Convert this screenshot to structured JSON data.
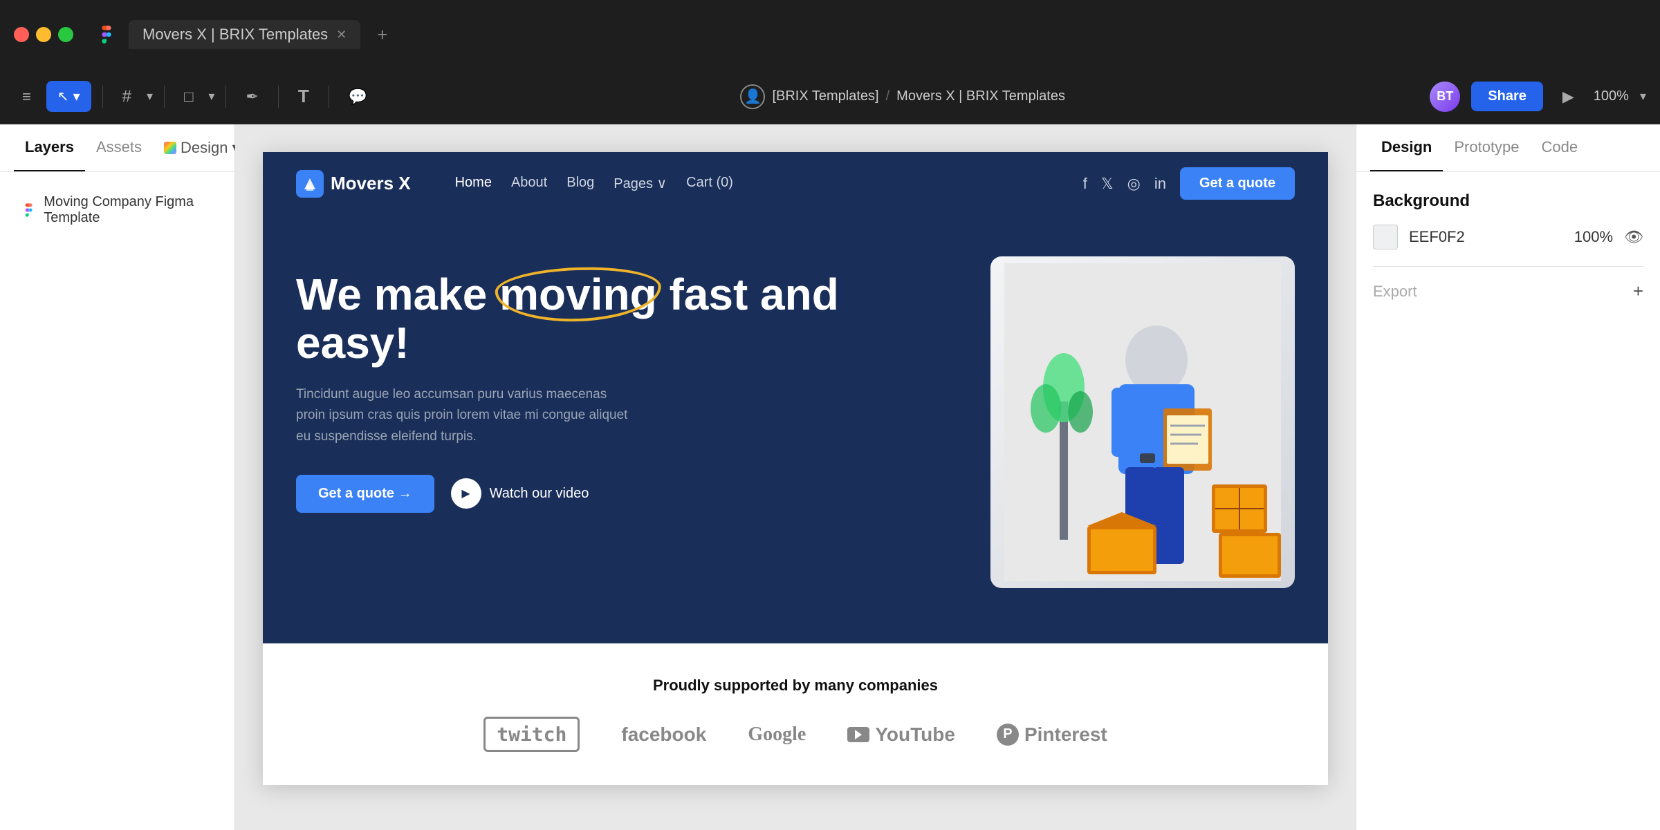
{
  "titlebar": {
    "tab_title": "Movers X | BRIX Templates",
    "plus_label": "+",
    "menu_icon": "≡",
    "figma_color_1": "#F24E1E",
    "figma_color_2": "#FF7262",
    "figma_color_3": "#A259FF",
    "figma_color_4": "#1ABCFE"
  },
  "toolbar": {
    "breadcrumb_org": "[BRIX Templates]",
    "breadcrumb_sep": "/",
    "breadcrumb_project": "Movers X | BRIX Templates",
    "share_label": "Share",
    "zoom_label": "100%"
  },
  "left_sidebar": {
    "tab_layers": "Layers",
    "tab_assets": "Assets",
    "tab_design": "Design",
    "layer_item": "Moving Company Figma Template"
  },
  "right_panel": {
    "tab_design": "Design",
    "tab_prototype": "Prototype",
    "tab_code": "Code",
    "section_background": "Background",
    "color_hex": "EEF0F2",
    "opacity": "100%",
    "export_label": "Export",
    "export_add": "+"
  },
  "website": {
    "logo_text": "Movers X",
    "nav_home": "Home",
    "nav_about": "About",
    "nav_blog": "Blog",
    "nav_pages": "Pages ∨",
    "nav_cart": "Cart (0)",
    "nav_cta": "Get a quote",
    "hero_title_main": "We make ",
    "hero_title_highlight": "moving",
    "hero_title_end": " fast and easy!",
    "hero_subtitle": "Tincidunt augue leo accumsan puru varius maecenas proin ipsum cras quis proin lorem vitae mi congue aliquet eu suspendisse eleifend turpis.",
    "hero_cta": "Get a quote →",
    "hero_video_label": "Watch our video",
    "supporters_title": "Proudly supported by many companies",
    "brand_twitch": "twitch",
    "brand_facebook": "facebook",
    "brand_google": "Google",
    "brand_youtube": "YouTube",
    "brand_pinterest": "Pinterest"
  }
}
